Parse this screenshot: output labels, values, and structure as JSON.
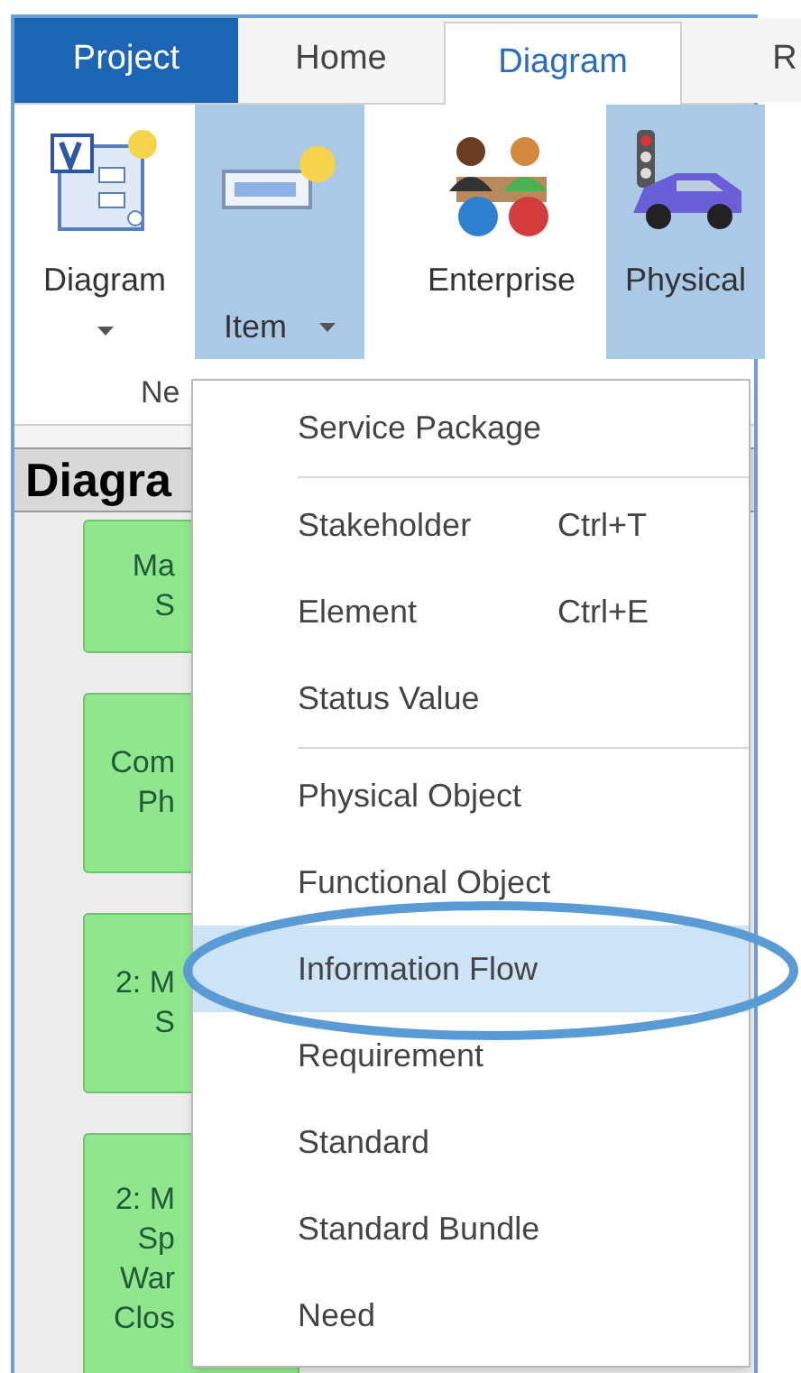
{
  "tabs": [
    {
      "label": "Project",
      "kind": "file",
      "selected": false
    },
    {
      "label": "Home",
      "kind": "tab",
      "selected": false
    },
    {
      "label": "Diagram",
      "kind": "tab",
      "selected": true
    },
    {
      "label": "R",
      "kind": "tab",
      "selected": false
    }
  ],
  "ribbon": {
    "buttons": [
      {
        "label": "Diagram",
        "kind": "diagram",
        "caret": true,
        "highlighted": false
      },
      {
        "label": "Item",
        "kind": "item",
        "caret": true,
        "highlighted": true
      },
      {
        "label": "Enterprise",
        "kind": "enterprise",
        "caret": false,
        "highlighted": false
      },
      {
        "label": "Physical",
        "kind": "physical",
        "caret": false,
        "highlighted": true
      }
    ],
    "group_label": "Ne"
  },
  "panel": {
    "title": "Diagra",
    "boxes": [
      {
        "lines": [
          "Ma",
          "S"
        ]
      },
      {
        "lines": [
          "Com",
          "Ph"
        ]
      },
      {
        "lines": [
          "2: M",
          "S"
        ]
      },
      {
        "lines": [
          "2: M",
          "Sp",
          "War",
          "Clos"
        ]
      }
    ]
  },
  "menu": {
    "items": [
      {
        "kind": "item",
        "label": "Service Package",
        "selected": false
      },
      {
        "kind": "separator"
      },
      {
        "kind": "item",
        "label": "Stakeholder",
        "shortcut": "Ctrl+T",
        "selected": false
      },
      {
        "kind": "item",
        "label": "Element",
        "shortcut": "Ctrl+E",
        "selected": false
      },
      {
        "kind": "item",
        "label": "Status Value",
        "selected": false
      },
      {
        "kind": "separator"
      },
      {
        "kind": "item",
        "label": "Physical Object",
        "selected": false
      },
      {
        "kind": "item",
        "label": "Functional Object",
        "selected": false
      },
      {
        "kind": "item",
        "label": "Information Flow",
        "selected": true
      },
      {
        "kind": "item",
        "label": "Requirement",
        "selected": false
      },
      {
        "kind": "item",
        "label": "Standard",
        "selected": false
      },
      {
        "kind": "item",
        "label": "Standard Bundle",
        "selected": false
      },
      {
        "kind": "item",
        "label": "Need",
        "selected": false
      }
    ]
  },
  "annotation": {
    "kind": "ellipse"
  }
}
